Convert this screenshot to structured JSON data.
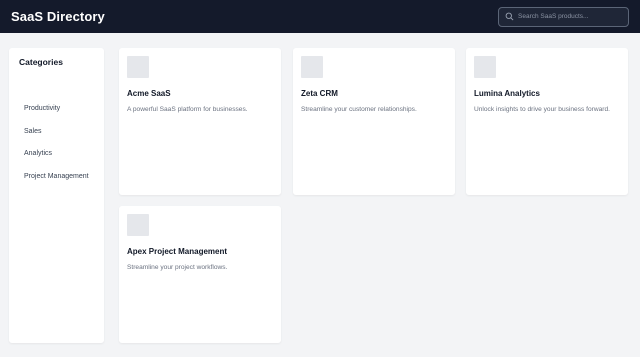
{
  "header": {
    "brand": "SaaS Directory",
    "search_placeholder": "Search SaaS products..."
  },
  "sidebar": {
    "title": "Categories",
    "items": [
      {
        "label": "Productivity"
      },
      {
        "label": "Sales"
      },
      {
        "label": "Analytics"
      },
      {
        "label": "Project Management"
      }
    ]
  },
  "products": [
    {
      "name": "Acme SaaS",
      "description": "A powerful SaaS platform for businesses."
    },
    {
      "name": "Zeta CRM",
      "description": "Streamline your customer relationships."
    },
    {
      "name": "Lumina Analytics",
      "description": "Unlock insights to drive your business forward."
    },
    {
      "name": "Apex Project Management",
      "description": "Streamline your project workflows."
    }
  ],
  "icons": {
    "search": "search-icon"
  },
  "colors": {
    "topbar": "#141a2b",
    "background": "#f3f4f6",
    "card": "#ffffff",
    "thumbnail": "#e5e7eb"
  }
}
